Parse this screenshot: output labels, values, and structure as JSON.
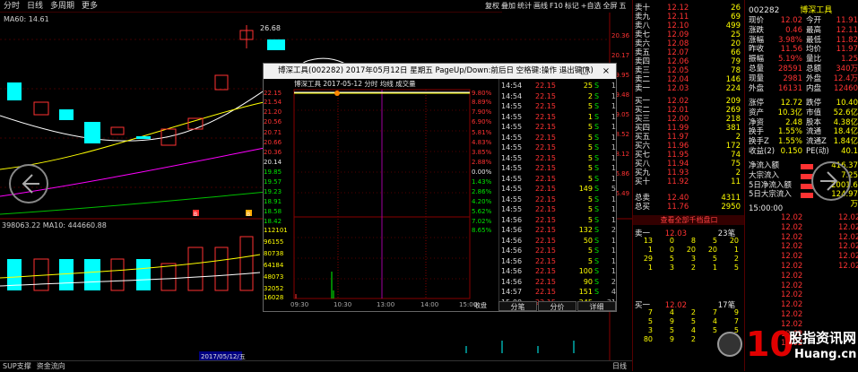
{
  "topbar": {
    "tabs": [
      "分时",
      "日线",
      "多周期",
      "更多"
    ],
    "menu": [
      "复权",
      "叠加",
      "统计",
      "画线",
      "F10",
      "标记",
      "+自选",
      "全屏",
      "五档",
      "返回"
    ]
  },
  "main_chart": {
    "ma_label": "MA60: 14.61",
    "high_label": "26.68",
    "vol_label": "398063.22  MA10: 444660.88",
    "date_label": "2017/05/12/五",
    "markers": [
      "B",
      "B"
    ]
  },
  "price_axis": [
    "20.36",
    "20.17",
    "19.95",
    "19.48",
    "19.05",
    "18.52",
    "18.12",
    "16.86",
    "16.49"
  ],
  "popup": {
    "title": "博深工具(002282) 2017年05月12日 星期五 PageUp/Down:前后日 空格键:操作 退出键(R)",
    "controls": [
      "–",
      "□",
      "×"
    ],
    "chart_title": "博深工具  2017-05-12 分时 均线 成交量",
    "left_axis": [
      "22.15",
      "21.54",
      "21.20",
      "20.56",
      "20.71",
      "20.66",
      "20.36",
      "20.14",
      "19.85",
      "19.57",
      "19.23",
      "18.91",
      "18.58",
      "18.42",
      "112101",
      "96155",
      "80738",
      "64184",
      "48073",
      "32052",
      "16028"
    ],
    "right_axis": [
      "9.80%",
      "8.89%",
      "7.90%",
      "6.90%",
      "5.81%",
      "4.83%",
      "3.85%",
      "2.88%",
      "0.00%",
      "1.43%",
      "2.86%",
      "4.20%",
      "5.62%",
      "7.02%",
      "8.65%"
    ],
    "x_axis": [
      "09:30",
      "10:30",
      "13:00",
      "14:00",
      "15:00"
    ],
    "ticks": [
      {
        "t": "14:54",
        "p": "22.15",
        "v": "25",
        "s": "S",
        "n": "1"
      },
      {
        "t": "14:54",
        "p": "22.15",
        "v": "2",
        "s": "S",
        "n": "1"
      },
      {
        "t": "14:55",
        "p": "22.15",
        "v": "5",
        "s": "S",
        "n": "1"
      },
      {
        "t": "14:55",
        "p": "22.15",
        "v": "1",
        "s": "S",
        "n": "1"
      },
      {
        "t": "14:55",
        "p": "22.15",
        "v": "5",
        "s": "S",
        "n": "1"
      },
      {
        "t": "14:55",
        "p": "22.15",
        "v": "5",
        "s": "S",
        "n": "1"
      },
      {
        "t": "14:55",
        "p": "22.15",
        "v": "5",
        "s": "S",
        "n": "1"
      },
      {
        "t": "14:55",
        "p": "22.15",
        "v": "5",
        "s": "S",
        "n": "1"
      },
      {
        "t": "14:55",
        "p": "22.15",
        "v": "5",
        "s": "S",
        "n": "1"
      },
      {
        "t": "14:55",
        "p": "22.15",
        "v": "5",
        "s": "S",
        "n": "1"
      },
      {
        "t": "14:55",
        "p": "22.15",
        "v": "149",
        "s": "S",
        "n": "5"
      },
      {
        "t": "14:55",
        "p": "22.15",
        "v": "5",
        "s": "S",
        "n": "1"
      },
      {
        "t": "14:55",
        "p": "22.15",
        "v": "5",
        "s": "S",
        "n": "1"
      },
      {
        "t": "14:56",
        "p": "22.15",
        "v": "5",
        "s": "S",
        "n": "1"
      },
      {
        "t": "14:56",
        "p": "22.15",
        "v": "132",
        "s": "S",
        "n": "2"
      },
      {
        "t": "14:56",
        "p": "22.15",
        "v": "50",
        "s": "S",
        "n": "1"
      },
      {
        "t": "14:56",
        "p": "22.15",
        "v": "5",
        "s": "S",
        "n": "1"
      },
      {
        "t": "14:56",
        "p": "22.15",
        "v": "5",
        "s": "S",
        "n": "1"
      },
      {
        "t": "14:56",
        "p": "22.15",
        "v": "100",
        "s": "S",
        "n": "1"
      },
      {
        "t": "14:56",
        "p": "22.15",
        "v": "90",
        "s": "S",
        "n": "2"
      },
      {
        "t": "14:57",
        "p": "22.15",
        "v": "151",
        "s": "S",
        "n": "4"
      },
      {
        "t": "15:00",
        "p": "22.15",
        "v": "245",
        "s": "",
        "n": "31"
      }
    ],
    "buttons": [
      "分笔",
      "分价",
      "详细"
    ],
    "extra_labels": [
      "收盘"
    ]
  },
  "orderbook": {
    "sells": [
      {
        "l": "卖十",
        "p": "12.12",
        "v": "26"
      },
      {
        "l": "卖九",
        "p": "12.11",
        "v": "69"
      },
      {
        "l": "卖八",
        "p": "12.10",
        "v": "499"
      },
      {
        "l": "卖七",
        "p": "12.09",
        "v": "25"
      },
      {
        "l": "卖六",
        "p": "12.08",
        "v": "20"
      },
      {
        "l": "卖五",
        "p": "12.07",
        "v": "66"
      },
      {
        "l": "卖四",
        "p": "12.06",
        "v": "79"
      },
      {
        "l": "卖三",
        "p": "12.05",
        "v": "78"
      },
      {
        "l": "卖二",
        "p": "12.04",
        "v": "146"
      },
      {
        "l": "卖一",
        "p": "12.03",
        "v": "224"
      }
    ],
    "buys": [
      {
        "l": "买一",
        "p": "12.02",
        "v": "209"
      },
      {
        "l": "买二",
        "p": "12.01",
        "v": "269"
      },
      {
        "l": "买三",
        "p": "12.00",
        "v": "218"
      },
      {
        "l": "买四",
        "p": "11.99",
        "v": "381"
      },
      {
        "l": "买五",
        "p": "11.97",
        "v": "2"
      },
      {
        "l": "买六",
        "p": "11.96",
        "v": "172"
      },
      {
        "l": "买七",
        "p": "11.95",
        "v": "74"
      },
      {
        "l": "买八",
        "p": "11.94",
        "v": "75"
      },
      {
        "l": "买九",
        "p": "11.93",
        "v": "2"
      },
      {
        "l": "买十",
        "p": "11.92",
        "v": "11"
      }
    ],
    "totals": [
      {
        "l": "总卖",
        "p": "12.40",
        "v": "4311"
      },
      {
        "l": "总买",
        "p": "11.76",
        "v": "2950"
      }
    ],
    "queue_title": "查看全部千档盘口",
    "sell1_label": "卖一",
    "sell1_price": "12.03",
    "sell1_count": "23笔",
    "sell1_queue": [
      [
        "13",
        "0",
        "8",
        "5",
        "20"
      ],
      [
        "1",
        "0",
        "20",
        "20",
        "1"
      ],
      [
        "29",
        "5",
        "3",
        "5",
        "2"
      ],
      [
        "1",
        "3",
        "2",
        "1",
        "5"
      ]
    ],
    "buy1_label": "买一",
    "buy1_price": "12.02",
    "buy1_count": "17笔",
    "buy1_queue": [
      [
        "7",
        "4",
        "2",
        "7",
        "9"
      ],
      [
        "5",
        "9",
        "5",
        "4",
        "7"
      ],
      [
        "3",
        "5",
        "4",
        "5",
        "5"
      ],
      [
        "80",
        "9",
        "2",
        "",
        ""
      ]
    ]
  },
  "quote": {
    "code": "002282",
    "name": "博深工具",
    "rows": [
      [
        "现价",
        "12.02",
        "今开",
        "11.91"
      ],
      [
        "涨跌",
        "0.46",
        "最高",
        "12.11"
      ],
      [
        "涨幅",
        "3.98%",
        "最低",
        "11.82"
      ],
      [
        "昨收",
        "11.56",
        "均价",
        "11.97"
      ],
      [
        "振幅",
        "5.19%",
        "量比",
        "1.25"
      ],
      [
        "总量",
        "28591",
        "总额",
        "340万"
      ],
      [
        "现量",
        "2981",
        "外盘",
        "12.4万"
      ],
      [
        "外盘",
        "16131",
        "内盘",
        "12460"
      ]
    ],
    "rows2": [
      [
        "涨停",
        "12.72",
        "跌停",
        "10.40"
      ],
      [
        "资产",
        "10.3亿",
        "市值",
        "52.6亿"
      ],
      [
        "净资",
        "2.48",
        "股本",
        "4.38亿"
      ],
      [
        "换手",
        "1.55%",
        "流通",
        "18.4亿"
      ],
      [
        "换手Z",
        "1.55%",
        "流通Z",
        "1.84亿"
      ],
      [
        "收益(2)",
        "0.150",
        "PE(动)",
        "40.1"
      ]
    ],
    "flows": [
      {
        "label": "净流入额",
        "value": "416.37"
      },
      {
        "label": "大宗流入",
        "value": "7.25"
      },
      {
        "label": "5日净流入额",
        "value": "2001.67"
      },
      {
        "label": "5日大宗流入",
        "value": "124.97万"
      }
    ],
    "time_label": "15:00:00",
    "time_ticks": [
      [
        "12.02",
        "5"
      ],
      [
        "12.02",
        "7"
      ],
      [
        "12.02",
        "8"
      ],
      [
        "12.02",
        "1"
      ],
      [
        "12.02",
        "4"
      ],
      [
        "12.02",
        "3"
      ],
      [
        "12.02",
        "5"
      ],
      [
        "12.02",
        "9"
      ],
      [
        "12.02",
        "2"
      ],
      [
        "12.02",
        "6"
      ],
      [
        "12.02",
        "3"
      ],
      [
        "12.02",
        "7"
      ],
      [
        "12.02",
        "5"
      ],
      [
        "12.02",
        "2"
      ],
      [
        "12.02",
        "4"
      ],
      [
        "12.02",
        "1"
      ],
      [
        "12.02",
        "3"
      ],
      [
        "12.02",
        "8"
      ],
      [
        "12.02",
        "5"
      ],
      [
        "12.02",
        "6"
      ]
    ]
  },
  "bottombar": {
    "tabs": [
      "SUP支撑",
      "资金流向"
    ],
    "right": "日线"
  },
  "watermark": {
    "number": "10",
    "site_top": "股指资讯网",
    "site_bottom": "Huang.cn"
  },
  "colors": {
    "up": "#ff3232",
    "down": "#00ffff",
    "ma": "#ffffff",
    "vol_ma": "#ffff00"
  }
}
